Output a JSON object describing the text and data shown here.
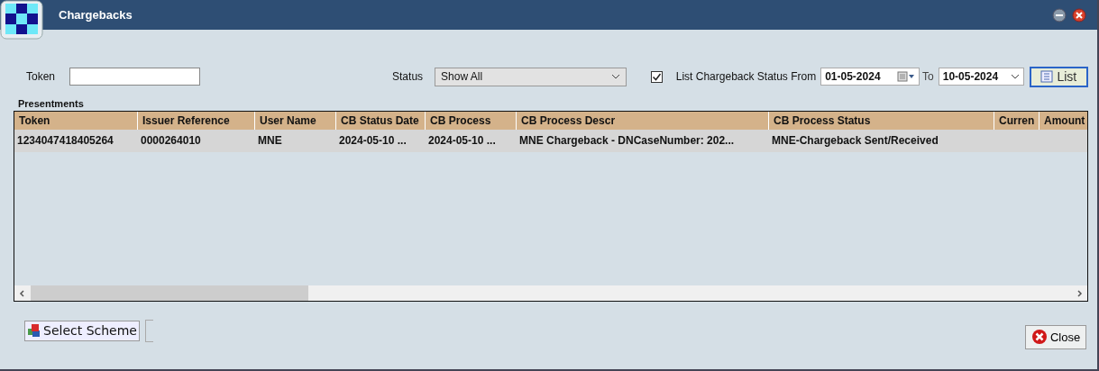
{
  "window": {
    "title": "Chargebacks"
  },
  "filters": {
    "token_label": "Token",
    "status_label": "Status",
    "status_value": "Show All",
    "range_checked": true,
    "range_label": "List Chargeback Status From",
    "date_from": "01-05-2024",
    "to_label": "To",
    "date_to": "10-05-2024",
    "list_button": "List"
  },
  "presentments": {
    "title": "Presentments",
    "columns": [
      "Token",
      "Issuer Reference",
      "User Name",
      "CB Status Date",
      "CB Process",
      "CB Process Descr",
      "CB Process Status",
      "Curren",
      "Amount"
    ],
    "rows": [
      {
        "selected": true,
        "cells": [
          "1234047418405264",
          "0000264010",
          "MNE",
          "2024-05-10 ...",
          "2024-05-10 ...",
          "MNE Chargeback - DNCaseNumber: 202...",
          "MNE-Chargeback Sent/Received",
          "",
          ""
        ]
      }
    ]
  },
  "buttons": {
    "select_scheme": "Select Scheme",
    "close": "Close"
  }
}
